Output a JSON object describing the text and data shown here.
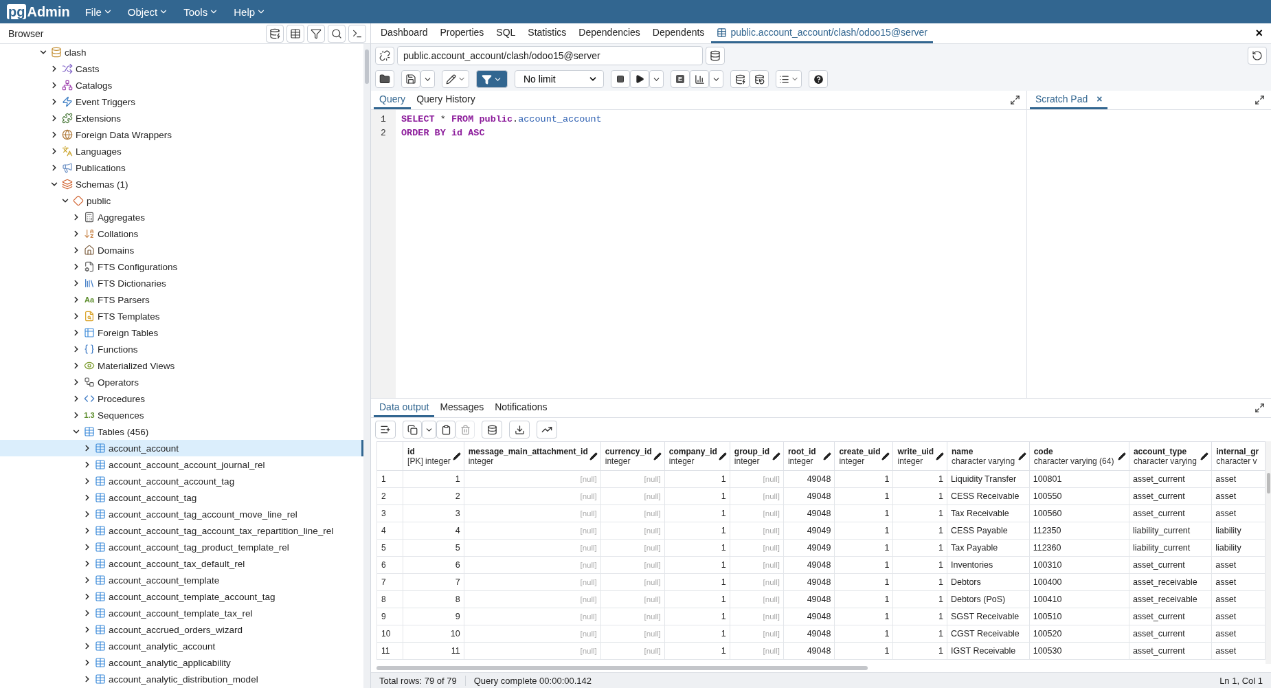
{
  "app": {
    "logo_box": "pg",
    "logo_text": "Admin",
    "menus": [
      "File",
      "Object",
      "Tools",
      "Help"
    ]
  },
  "browser": {
    "title": "Browser",
    "tree": [
      {
        "label": "clash",
        "kind": "database",
        "expanded": true,
        "selected": false,
        "children": [
          {
            "label": "Casts",
            "kind": "cast",
            "expanded": false,
            "selected": false
          },
          {
            "label": "Catalogs",
            "kind": "catalog",
            "expanded": false,
            "selected": false
          },
          {
            "label": "Event Triggers",
            "kind": "trigger",
            "expanded": false,
            "selected": false
          },
          {
            "label": "Extensions",
            "kind": "extension",
            "expanded": false,
            "selected": false
          },
          {
            "label": "Foreign Data Wrappers",
            "kind": "fdw",
            "expanded": false,
            "selected": false
          },
          {
            "label": "Languages",
            "kind": "language",
            "expanded": false,
            "selected": false
          },
          {
            "label": "Publications",
            "kind": "publication",
            "expanded": false,
            "selected": false
          },
          {
            "label": "Schemas (1)",
            "kind": "schemas",
            "expanded": true,
            "selected": false,
            "children": [
              {
                "label": "public",
                "kind": "schema",
                "expanded": true,
                "selected": false,
                "children": [
                  {
                    "label": "Aggregates",
                    "kind": "aggregate",
                    "expanded": false,
                    "selected": false
                  },
                  {
                    "label": "Collations",
                    "kind": "collation",
                    "expanded": false,
                    "selected": false
                  },
                  {
                    "label": "Domains",
                    "kind": "domain",
                    "expanded": false,
                    "selected": false
                  },
                  {
                    "label": "FTS Configurations",
                    "kind": "fts_config",
                    "expanded": false,
                    "selected": false
                  },
                  {
                    "label": "FTS Dictionaries",
                    "kind": "fts_dict",
                    "expanded": false,
                    "selected": false
                  },
                  {
                    "label": "FTS Parsers",
                    "kind": "glyph",
                    "glyph": "Aa",
                    "expanded": false,
                    "selected": false
                  },
                  {
                    "label": "FTS Templates",
                    "kind": "fts_template",
                    "expanded": false,
                    "selected": false
                  },
                  {
                    "label": "Foreign Tables",
                    "kind": "foreign_table",
                    "expanded": false,
                    "selected": false
                  },
                  {
                    "label": "Functions",
                    "kind": "function",
                    "expanded": false,
                    "selected": false
                  },
                  {
                    "label": "Materialized Views",
                    "kind": "matview",
                    "expanded": false,
                    "selected": false
                  },
                  {
                    "label": "Operators",
                    "kind": "operator",
                    "expanded": false,
                    "selected": false
                  },
                  {
                    "label": "Procedures",
                    "kind": "procedure",
                    "expanded": false,
                    "selected": false
                  },
                  {
                    "label": "Sequences",
                    "kind": "glyph",
                    "glyph": "1.3",
                    "expanded": false,
                    "selected": false
                  },
                  {
                    "label": "Tables (456)",
                    "kind": "table",
                    "expanded": true,
                    "selected": false,
                    "children": [
                      {
                        "label": "account_account",
                        "kind": "table",
                        "expanded": false,
                        "selected": true
                      },
                      {
                        "label": "account_account_account_journal_rel",
                        "kind": "table",
                        "expanded": false,
                        "selected": false
                      },
                      {
                        "label": "account_account_account_tag",
                        "kind": "table",
                        "expanded": false,
                        "selected": false
                      },
                      {
                        "label": "account_account_tag",
                        "kind": "table",
                        "expanded": false,
                        "selected": false
                      },
                      {
                        "label": "account_account_tag_account_move_line_rel",
                        "kind": "table",
                        "expanded": false,
                        "selected": false
                      },
                      {
                        "label": "account_account_tag_account_tax_repartition_line_rel",
                        "kind": "table",
                        "expanded": false,
                        "selected": false
                      },
                      {
                        "label": "account_account_tag_product_template_rel",
                        "kind": "table",
                        "expanded": false,
                        "selected": false
                      },
                      {
                        "label": "account_account_tax_default_rel",
                        "kind": "table",
                        "expanded": false,
                        "selected": false
                      },
                      {
                        "label": "account_account_template",
                        "kind": "table",
                        "expanded": false,
                        "selected": false
                      },
                      {
                        "label": "account_account_template_account_tag",
                        "kind": "table",
                        "expanded": false,
                        "selected": false
                      },
                      {
                        "label": "account_account_template_tax_rel",
                        "kind": "table",
                        "expanded": false,
                        "selected": false
                      },
                      {
                        "label": "account_accrued_orders_wizard",
                        "kind": "table",
                        "expanded": false,
                        "selected": false
                      },
                      {
                        "label": "account_analytic_account",
                        "kind": "table",
                        "expanded": false,
                        "selected": false
                      },
                      {
                        "label": "account_analytic_applicability",
                        "kind": "table",
                        "expanded": false,
                        "selected": false
                      },
                      {
                        "label": "account_analytic_distribution_model",
                        "kind": "table",
                        "expanded": false,
                        "selected": false
                      }
                    ]
                  }
                ]
              }
            ]
          }
        ]
      }
    ]
  },
  "main_tabs": [
    {
      "label": "Dashboard",
      "selected": false,
      "kind": "plain"
    },
    {
      "label": "Properties",
      "selected": false,
      "kind": "plain"
    },
    {
      "label": "SQL",
      "selected": false,
      "kind": "plain"
    },
    {
      "label": "Statistics",
      "selected": false,
      "kind": "plain"
    },
    {
      "label": "Dependencies",
      "selected": false,
      "kind": "plain"
    },
    {
      "label": "Dependents",
      "selected": false,
      "kind": "plain"
    },
    {
      "label": "public.account_account/clash/odoo15@server",
      "selected": true,
      "kind": "query"
    }
  ],
  "close_all": "×",
  "connection": {
    "value": "public.account_account/clash/odoo15@server"
  },
  "toolbar": {
    "filter_active": true,
    "limit": "No limit",
    "explain": "E"
  },
  "editor": {
    "tabs": [
      {
        "label": "Query",
        "selected": true
      },
      {
        "label": "Query History",
        "selected": false
      }
    ],
    "lines": [
      {
        "number": "1",
        "tokens": [
          {
            "text": "SELECT",
            "kind": "keyword"
          },
          {
            "text": " * ",
            "kind": "plain"
          },
          {
            "text": "FROM public",
            "kind": "keyword"
          },
          {
            "text": ".",
            "kind": "plain"
          },
          {
            "text": "account_account",
            "kind": "name"
          }
        ]
      },
      {
        "number": "2",
        "tokens": [
          {
            "text": "ORDER BY id ASC",
            "kind": "keyword"
          }
        ]
      }
    ]
  },
  "scratch_pad": {
    "label": "Scratch Pad",
    "close": "×",
    "selected": true
  },
  "results": {
    "tabs": [
      {
        "label": "Data output",
        "selected": true
      },
      {
        "label": "Messages",
        "selected": false
      },
      {
        "label": "Notifications",
        "selected": false
      }
    ],
    "delete_disabled": true,
    "columns": [
      {
        "name": "id",
        "type": "[PK] integer",
        "kind": "number"
      },
      {
        "name": "message_main_attachment_id",
        "type": "integer",
        "kind": "number"
      },
      {
        "name": "currency_id",
        "type": "integer",
        "kind": "number"
      },
      {
        "name": "company_id",
        "type": "integer",
        "kind": "number"
      },
      {
        "name": "group_id",
        "type": "integer",
        "kind": "number"
      },
      {
        "name": "root_id",
        "type": "integer",
        "kind": "number"
      },
      {
        "name": "create_uid",
        "type": "integer",
        "kind": "number"
      },
      {
        "name": "write_uid",
        "type": "integer",
        "kind": "number"
      },
      {
        "name": "name",
        "type": "character varying",
        "kind": "text"
      },
      {
        "name": "code",
        "type": "character varying (64)",
        "kind": "text"
      },
      {
        "name": "account_type",
        "type": "character varying",
        "kind": "text"
      },
      {
        "name": "internal_gr",
        "type": "character v",
        "kind": "text"
      }
    ],
    "rows": [
      {
        "number": "1",
        "cells": [
          "1",
          {
            "text": "[null]",
            "is_null": true
          },
          {
            "text": "[null]",
            "is_null": true
          },
          "1",
          {
            "text": "[null]",
            "is_null": true
          },
          "49048",
          "1",
          "1",
          "Liquidity Transfer",
          "100801",
          "asset_current",
          "asset"
        ]
      },
      {
        "number": "2",
        "cells": [
          "2",
          {
            "text": "[null]",
            "is_null": true
          },
          {
            "text": "[null]",
            "is_null": true
          },
          "1",
          {
            "text": "[null]",
            "is_null": true
          },
          "49048",
          "1",
          "1",
          "CESS Receivable",
          "100550",
          "asset_current",
          "asset"
        ]
      },
      {
        "number": "3",
        "cells": [
          "3",
          {
            "text": "[null]",
            "is_null": true
          },
          {
            "text": "[null]",
            "is_null": true
          },
          "1",
          {
            "text": "[null]",
            "is_null": true
          },
          "49048",
          "1",
          "1",
          "Tax Receivable",
          "100560",
          "asset_current",
          "asset"
        ]
      },
      {
        "number": "4",
        "cells": [
          "4",
          {
            "text": "[null]",
            "is_null": true
          },
          {
            "text": "[null]",
            "is_null": true
          },
          "1",
          {
            "text": "[null]",
            "is_null": true
          },
          "49049",
          "1",
          "1",
          "CESS Payable",
          "112350",
          "liability_current",
          "liability"
        ]
      },
      {
        "number": "5",
        "cells": [
          "5",
          {
            "text": "[null]",
            "is_null": true
          },
          {
            "text": "[null]",
            "is_null": true
          },
          "1",
          {
            "text": "[null]",
            "is_null": true
          },
          "49049",
          "1",
          "1",
          "Tax Payable",
          "112360",
          "liability_current",
          "liability"
        ]
      },
      {
        "number": "6",
        "cells": [
          "6",
          {
            "text": "[null]",
            "is_null": true
          },
          {
            "text": "[null]",
            "is_null": true
          },
          "1",
          {
            "text": "[null]",
            "is_null": true
          },
          "49048",
          "1",
          "1",
          "Inventories",
          "100310",
          "asset_current",
          "asset"
        ]
      },
      {
        "number": "7",
        "cells": [
          "7",
          {
            "text": "[null]",
            "is_null": true
          },
          {
            "text": "[null]",
            "is_null": true
          },
          "1",
          {
            "text": "[null]",
            "is_null": true
          },
          "49048",
          "1",
          "1",
          "Debtors",
          "100400",
          "asset_receivable",
          "asset"
        ]
      },
      {
        "number": "8",
        "cells": [
          "8",
          {
            "text": "[null]",
            "is_null": true
          },
          {
            "text": "[null]",
            "is_null": true
          },
          "1",
          {
            "text": "[null]",
            "is_null": true
          },
          "49048",
          "1",
          "1",
          "Debtors (PoS)",
          "100410",
          "asset_receivable",
          "asset"
        ]
      },
      {
        "number": "9",
        "cells": [
          "9",
          {
            "text": "[null]",
            "is_null": true
          },
          {
            "text": "[null]",
            "is_null": true
          },
          "1",
          {
            "text": "[null]",
            "is_null": true
          },
          "49048",
          "1",
          "1",
          "SGST Receivable",
          "100510",
          "asset_current",
          "asset"
        ]
      },
      {
        "number": "10",
        "cells": [
          "10",
          {
            "text": "[null]",
            "is_null": true
          },
          {
            "text": "[null]",
            "is_null": true
          },
          "1",
          {
            "text": "[null]",
            "is_null": true
          },
          "49048",
          "1",
          "1",
          "CGST Receivable",
          "100520",
          "asset_current",
          "asset"
        ]
      },
      {
        "number": "11",
        "cells": [
          "11",
          {
            "text": "[null]",
            "is_null": true
          },
          {
            "text": "[null]",
            "is_null": true
          },
          "1",
          {
            "text": "[null]",
            "is_null": true
          },
          "49048",
          "1",
          "1",
          "IGST Receivable",
          "100530",
          "asset_current",
          "asset"
        ]
      }
    ]
  },
  "status": {
    "rows": "Total rows: 79 of 79",
    "query": "Query complete 00:00:00.142",
    "cursor": "Ln 1, Col 1"
  }
}
